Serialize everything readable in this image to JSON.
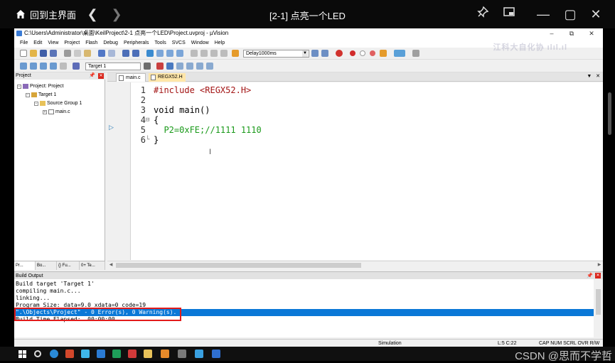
{
  "player": {
    "home_label": "回到主界面",
    "video_title": "[2-1] 点亮一个LED"
  },
  "ide": {
    "window_title": "C:\\Users\\Administrator\\桌面\\KeilProject\\2-1 点亮一个LED\\Project.uvproj - µVision",
    "menu": [
      "File",
      "Edit",
      "View",
      "Project",
      "Flash",
      "Debug",
      "Peripherals",
      "Tools",
      "SVCS",
      "Window",
      "Help"
    ],
    "toolbar": {
      "function_combo": "Delay1000ms",
      "target_combo": "Target 1"
    },
    "watermark_text": "江科大自化协 ılıl.ıl",
    "project_panel": {
      "title": "Project",
      "tree": [
        {
          "label": "Project: Project",
          "level": 0,
          "expander": "−"
        },
        {
          "label": "Target 1",
          "level": 1,
          "expander": "−"
        },
        {
          "label": "Source Group 1",
          "level": 2,
          "expander": "−"
        },
        {
          "label": "main.c",
          "level": 3,
          "expander": "+"
        }
      ],
      "tabs": [
        "Pr...",
        "Bo...",
        "{} Fu...",
        "0+ Te..."
      ]
    },
    "editor": {
      "tabs": [
        "main.c",
        "REGX52.H"
      ],
      "lines": [
        {
          "num": "1",
          "fold": "",
          "code": "#include <REGX52.H>",
          "kind": "preproc"
        },
        {
          "num": "2",
          "fold": "",
          "code": "",
          "kind": "plain"
        },
        {
          "num": "3",
          "fold": "",
          "code": "void main()",
          "kind": "plain"
        },
        {
          "num": "4",
          "fold": "⊟",
          "code": "{",
          "kind": "plain"
        },
        {
          "num": "5",
          "fold": "",
          "code": "  P2=0xFE;//1111 1110",
          "kind": "assign"
        },
        {
          "num": "6",
          "fold": "└",
          "code": "}",
          "kind": "plain"
        }
      ]
    },
    "build_output": {
      "title": "Build Output",
      "lines": [
        "Build target 'Target 1'",
        "compiling main.c...",
        "linking...",
        "Program Size: data=9.0 xdata=0 code=19",
        "\".\\Objects\\Project\" - 0 Error(s), 0 Warning(s).",
        "Build Time Elapsed:  00:00:00"
      ],
      "selected_line": 4
    },
    "status": {
      "mode": "Simulation",
      "position": "L:5 C:22",
      "indicators": "CAP NUM SCRL OVR R/W"
    }
  },
  "taskbar": {
    "watermark": "CSDN @思而不学哲"
  },
  "colors": {
    "selection": "#0a78d7",
    "highlight_box": "#e21b1b",
    "preproc": "#a31515",
    "hex_literal": "#1a9a1a",
    "comment": "#1a9a1a"
  }
}
